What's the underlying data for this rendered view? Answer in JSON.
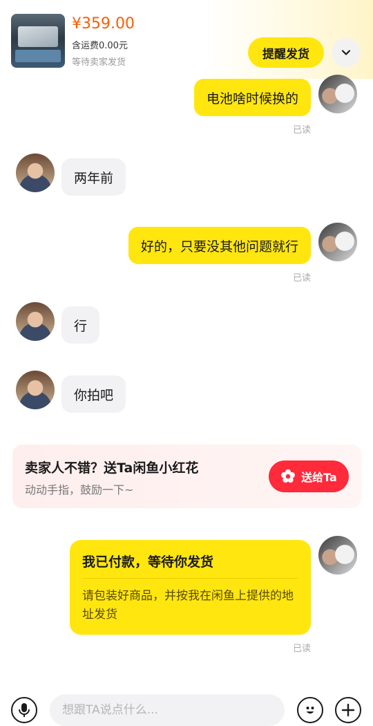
{
  "order": {
    "price": "¥359.00",
    "shipping_fee": "含运费0.00元",
    "status": "等待卖家发货",
    "remind_label": "提醒发货"
  },
  "messages": [
    {
      "from": "me",
      "text": "电池啥时候换的",
      "read": "已读"
    },
    {
      "from": "seller",
      "text": "两年前"
    },
    {
      "from": "me",
      "text": "好的，只要没其他问题就行",
      "read": "已读"
    },
    {
      "from": "seller",
      "text": "行"
    },
    {
      "from": "seller",
      "text": "你拍吧"
    }
  ],
  "flower_card": {
    "title": "卖家人不错？送Ta闲鱼小红花",
    "subtitle": "动动手指，鼓励一下~",
    "button_label": "送给Ta"
  },
  "paid_card": {
    "title": "我已付款，等待你发货",
    "body": "请包装好商品，并按我在闲鱼上提供的地址发货",
    "read": "已读"
  },
  "input": {
    "placeholder": "想跟TA说点什么..."
  },
  "colors": {
    "accent_yellow": "#ffe60f",
    "price_orange": "#ff5b00",
    "flower_red": "#ff2a3a"
  },
  "icons": [
    "chevron-down-icon",
    "flower-icon",
    "microphone-icon",
    "emoji-icon",
    "plus-icon"
  ]
}
